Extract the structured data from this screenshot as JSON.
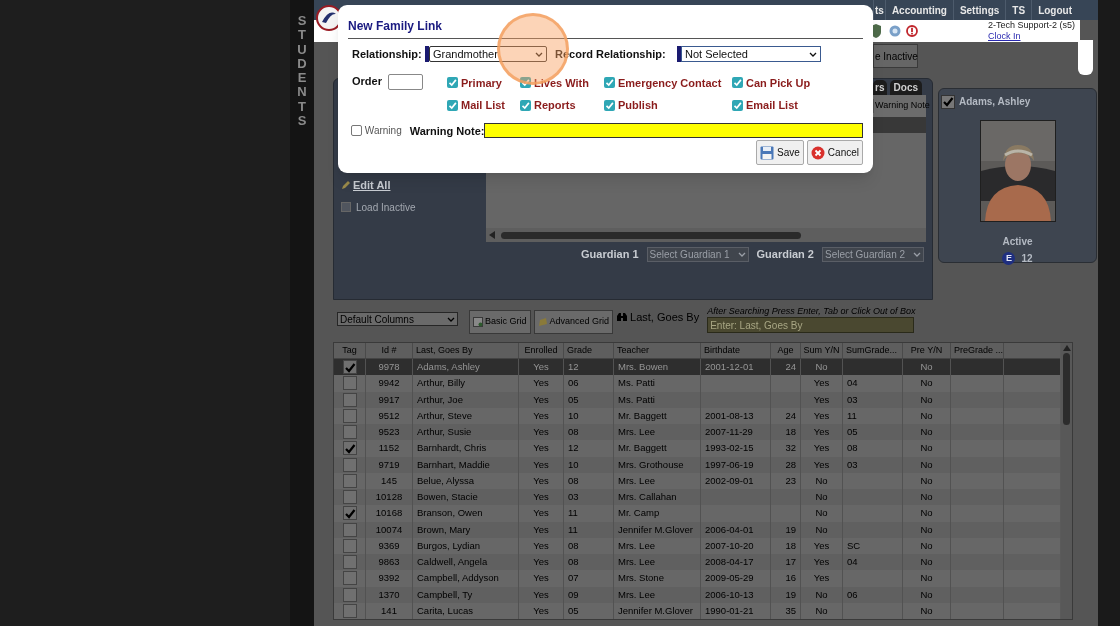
{
  "sidebar_label": "STUDENTS",
  "nav": {
    "items": [
      "ts",
      "Accounting",
      "Settings",
      "TS",
      "Logout"
    ]
  },
  "header": {
    "user": "2-Tech Support-2 (s5)",
    "clock_in": "Clock In"
  },
  "inactive_button": "e Inactive",
  "tabs": [
    {
      "label": "rs",
      "selected": false
    },
    {
      "label": "Docs",
      "selected": false
    }
  ],
  "detail_panel": {
    "column": "Warning Note",
    "edit_all": "Edit All",
    "load_inactive": {
      "label": "Load Inactive",
      "checked": false
    },
    "guardians": [
      {
        "label": "Guardian 1",
        "placeholder": "Select Guardian 1"
      },
      {
        "label": "Guardian 2",
        "placeholder": "Select Guardian 2"
      }
    ]
  },
  "student_card": {
    "name": "Adams, Ashley",
    "checked": true,
    "status": "Active",
    "badge": "E",
    "grade": "12"
  },
  "toolbar": {
    "columns_select": "Default Columns",
    "buttons": [
      {
        "kind": "basic",
        "label": "Basic Grid"
      },
      {
        "kind": "advanced",
        "label": "Advanced Grid"
      }
    ],
    "search_label": "Last, Goes By",
    "hint": "After Searching Press Enter, Tab or Click Out of Box",
    "search_placeholder": "Enter: Last, Goes By"
  },
  "grid": {
    "tag_column": "Tag",
    "columns": [
      "Id #",
      "Last, Goes By",
      "Enrolled",
      "Grade",
      "Teacher",
      "Birthdate",
      "Age",
      "Sum Y/N",
      "SumGrade...",
      "Pre Y/N",
      "PreGrade ..."
    ],
    "rows": [
      {
        "tagged": true,
        "selected": true,
        "cells": [
          "9978",
          "Adams, Ashley",
          "Yes",
          "12",
          "Mrs. Bowen",
          "2001-12-01",
          "24",
          "No",
          "",
          "No",
          ""
        ]
      },
      {
        "tagged": false,
        "selected": false,
        "cells": [
          "9942",
          "Arthur, Billy",
          "Yes",
          "06",
          "Ms. Patti",
          "",
          "",
          "Yes",
          "04",
          "No",
          ""
        ]
      },
      {
        "tagged": false,
        "selected": false,
        "cells": [
          "9917",
          "Arthur, Joe",
          "Yes",
          "05",
          "Ms. Patti",
          "",
          "",
          "Yes",
          "03",
          "No",
          ""
        ]
      },
      {
        "tagged": false,
        "selected": false,
        "cells": [
          "9512",
          "Arthur, Steve",
          "Yes",
          "10",
          "Mr. Baggett",
          "2001-08-13",
          "24",
          "Yes",
          "11",
          "No",
          ""
        ]
      },
      {
        "tagged": false,
        "selected": false,
        "cells": [
          "9523",
          "Arthur, Susie",
          "Yes",
          "08",
          "Mrs. Lee",
          "2007-11-29",
          "18",
          "Yes",
          "05",
          "No",
          ""
        ]
      },
      {
        "tagged": true,
        "selected": false,
        "cells": [
          "1152",
          "Barnhardt, Chris",
          "Yes",
          "12",
          "Mr. Baggett",
          "1993-02-15",
          "32",
          "Yes",
          "08",
          "No",
          ""
        ]
      },
      {
        "tagged": false,
        "selected": false,
        "cells": [
          "9719",
          "Barnhart, Maddie",
          "Yes",
          "10",
          "Mrs. Grothouse",
          "1997-06-19",
          "28",
          "Yes",
          "03",
          "No",
          ""
        ]
      },
      {
        "tagged": false,
        "selected": false,
        "cells": [
          "145",
          "Belue, Alyssa",
          "Yes",
          "08",
          "Mrs. Lee",
          "2002-09-01",
          "23",
          "No",
          "",
          "No",
          ""
        ]
      },
      {
        "tagged": false,
        "selected": false,
        "cells": [
          "10128",
          "Bowen, Stacie",
          "Yes",
          "03",
          "Mrs. Callahan",
          "",
          "",
          "No",
          "",
          "No",
          ""
        ]
      },
      {
        "tagged": true,
        "selected": false,
        "cells": [
          "10168",
          "Branson, Owen",
          "Yes",
          "11",
          "Mr. Camp",
          "",
          "",
          "No",
          "",
          "No",
          ""
        ]
      },
      {
        "tagged": false,
        "selected": false,
        "cells": [
          "10074",
          "Brown, Mary",
          "Yes",
          "11",
          "Jennifer M.Glover",
          "2006-04-01",
          "19",
          "No",
          "",
          "No",
          ""
        ]
      },
      {
        "tagged": false,
        "selected": false,
        "cells": [
          "9369",
          "Burgos, Lydian",
          "Yes",
          "08",
          "Mrs. Lee",
          "2007-10-20",
          "18",
          "Yes",
          "SC",
          "No",
          ""
        ]
      },
      {
        "tagged": false,
        "selected": false,
        "cells": [
          "9863",
          "Caldwell, Angela",
          "Yes",
          "08",
          "Mrs. Lee",
          "2008-04-17",
          "17",
          "Yes",
          "04",
          "No",
          ""
        ]
      },
      {
        "tagged": false,
        "selected": false,
        "cells": [
          "9392",
          "Campbell, Addyson",
          "Yes",
          "07",
          "Mrs. Stone",
          "2009-05-29",
          "16",
          "Yes",
          "",
          "No",
          ""
        ]
      },
      {
        "tagged": false,
        "selected": false,
        "cells": [
          "1370",
          "Campbell, Ty",
          "Yes",
          "09",
          "Mrs. Lee",
          "2006-10-13",
          "19",
          "No",
          "06",
          "No",
          ""
        ]
      },
      {
        "tagged": false,
        "selected": false,
        "cells": [
          "141",
          "Carita, Lucas",
          "Yes",
          "05",
          "Jennifer M.Glover",
          "1990-01-21",
          "35",
          "No",
          "",
          "No",
          ""
        ]
      }
    ]
  },
  "dialog": {
    "title": "New Family Link",
    "relationship": {
      "label": "Relationship:",
      "value": "Grandmother"
    },
    "record_relationship": {
      "label": "Record Relationship:",
      "value": "Not Selected"
    },
    "order_label": "Order",
    "options": [
      {
        "label": "Primary",
        "checked": true
      },
      {
        "label": "Lives With",
        "checked": true
      },
      {
        "label": "Emergency Contact",
        "checked": true
      },
      {
        "label": "Can Pick Up",
        "checked": true
      },
      {
        "label": "Mail List",
        "checked": true
      },
      {
        "label": "Reports",
        "checked": true
      },
      {
        "label": "Publish",
        "checked": true
      },
      {
        "label": "Email List",
        "checked": true
      }
    ],
    "warning": {
      "label": "Warning",
      "checked": false
    },
    "warning_note_label": "Warning Note:",
    "buttons": [
      {
        "kind": "save",
        "label": "Save"
      },
      {
        "kind": "cancel",
        "label": "Cancel"
      }
    ]
  }
}
